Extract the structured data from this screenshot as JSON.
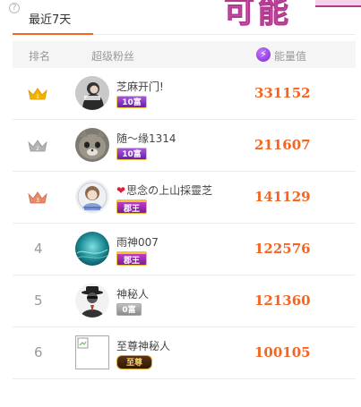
{
  "banner": {
    "text": "可能"
  },
  "tabs": {
    "active_label": "最近7天"
  },
  "header": {
    "rank": "排名",
    "fans": "超级粉丝",
    "energy": "能量值",
    "energy_icon": "lightning-icon"
  },
  "colors": {
    "accent": "#f26522",
    "gold": "#f1b300",
    "silver": "#b3b3b3",
    "bronze": "#e58a6a"
  },
  "rows": [
    {
      "rank": "1",
      "crown": "gold",
      "name": "芝麻开门!",
      "badge": "10富",
      "badge_style": "purple",
      "energy": "331152",
      "heart": ""
    },
    {
      "rank": "2",
      "crown": "silver",
      "name": "随～缘1314",
      "badge": "10富",
      "badge_style": "purple",
      "energy": "211607",
      "heart": ""
    },
    {
      "rank": "3",
      "crown": "bronze",
      "name": "思念の上山採靈芝",
      "badge": "郡王",
      "badge_style": "king",
      "energy": "141129",
      "heart": "❤"
    },
    {
      "rank": "4",
      "crown": "",
      "name": "雨神007",
      "badge": "郡王",
      "badge_style": "king",
      "energy": "122576",
      "heart": ""
    },
    {
      "rank": "5",
      "crown": "",
      "name": "神秘人",
      "badge": "0富",
      "badge_style": "gray",
      "energy": "121360",
      "heart": ""
    },
    {
      "rank": "6",
      "crown": "",
      "name": "至尊神秘人",
      "badge": "至尊",
      "badge_style": "supreme",
      "energy": "100105",
      "heart": ""
    }
  ]
}
